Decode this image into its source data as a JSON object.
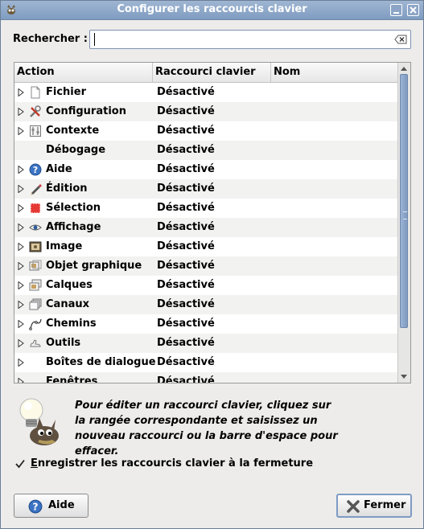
{
  "window": {
    "title": "Configurer les raccourcis clavier"
  },
  "search": {
    "label": "Rechercher :",
    "value": ""
  },
  "columns": {
    "action": "Action",
    "shortcut": "Raccourci clavier",
    "name": "Nom"
  },
  "rows": [
    {
      "name": "Fichier",
      "shortcut": "Désactivé",
      "icon": "file-icon",
      "expandable": true
    },
    {
      "name": "Configuration",
      "shortcut": "Désactivé",
      "icon": "tools-icon",
      "expandable": true
    },
    {
      "name": "Contexte",
      "shortcut": "Désactivé",
      "icon": "sliders-icon",
      "expandable": true
    },
    {
      "name": "Débogage",
      "shortcut": "Désactivé",
      "icon": "",
      "expandable": false
    },
    {
      "name": "Aide",
      "shortcut": "Désactivé",
      "icon": "help-icon",
      "expandable": true
    },
    {
      "name": "Édition",
      "shortcut": "Désactivé",
      "icon": "pencil-icon",
      "expandable": true
    },
    {
      "name": "Sélection",
      "shortcut": "Désactivé",
      "icon": "selection-icon",
      "expandable": true
    },
    {
      "name": "Affichage",
      "shortcut": "Désactivé",
      "icon": "eye-icon",
      "expandable": true
    },
    {
      "name": "Image",
      "shortcut": "Désactivé",
      "icon": "image-icon",
      "expandable": true
    },
    {
      "name": "Objet graphique",
      "shortcut": "Désactivé",
      "icon": "drawable-icon",
      "expandable": true
    },
    {
      "name": "Calques",
      "shortcut": "Désactivé",
      "icon": "layers-icon",
      "expandable": true
    },
    {
      "name": "Canaux",
      "shortcut": "Désactivé",
      "icon": "channels-icon",
      "expandable": true
    },
    {
      "name": "Chemins",
      "shortcut": "Désactivé",
      "icon": "paths-icon",
      "expandable": true
    },
    {
      "name": "Outils",
      "shortcut": "Désactivé",
      "icon": "tools-shoe-icon",
      "expandable": true
    },
    {
      "name": "Boîtes de dialogue",
      "shortcut": "Désactivé",
      "icon": "",
      "expandable": true
    },
    {
      "name": "Fenêtres",
      "shortcut": "Désactivé",
      "icon": "",
      "expandable": true
    }
  ],
  "help": {
    "text": "Pour éditer un raccourci clavier, cliquez sur la rangée correspondante et saisissez un nouveau raccourci ou la barre d'espace pour effacer."
  },
  "save_option": {
    "label": "Enregistrer les raccourcis clavier à la fermeture",
    "checked": true
  },
  "buttons": {
    "help": "Aide",
    "close": "Fermer"
  }
}
